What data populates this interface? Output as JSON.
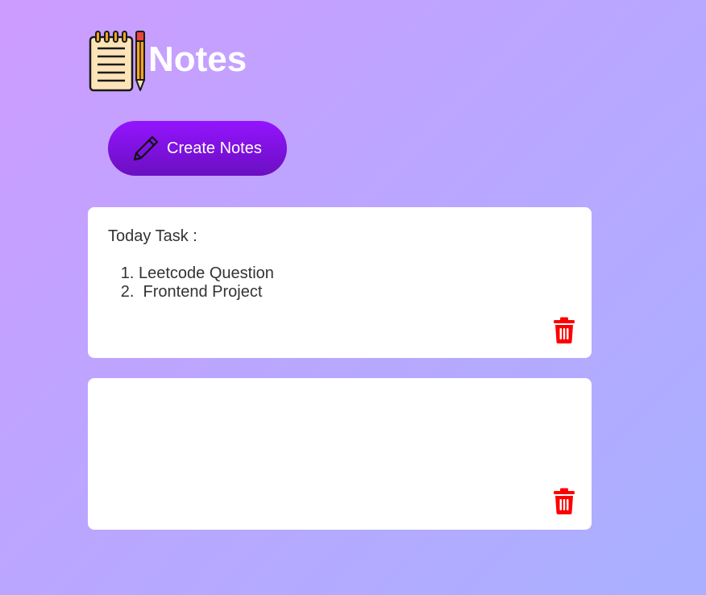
{
  "app": {
    "title": "Notes",
    "logo_icon": "notepad-pencil-icon"
  },
  "toolbar": {
    "create_label": "Create Notes",
    "create_icon": "pencil-icon"
  },
  "notes": [
    {
      "heading": "Today Task :",
      "items": [
        "Leetcode Question",
        " Frontend Project"
      ],
      "delete_icon": "trash-icon"
    },
    {
      "heading": "",
      "items": [],
      "delete_icon": "trash-icon"
    }
  ],
  "colors": {
    "background_start": "#cd9cff",
    "background_end": "#a9b0ff",
    "button_start": "#9414ff",
    "button_end": "#6a0fc0",
    "delete_red": "#ff0000",
    "note_bg": "#ffffff",
    "note_text": "#333333"
  }
}
